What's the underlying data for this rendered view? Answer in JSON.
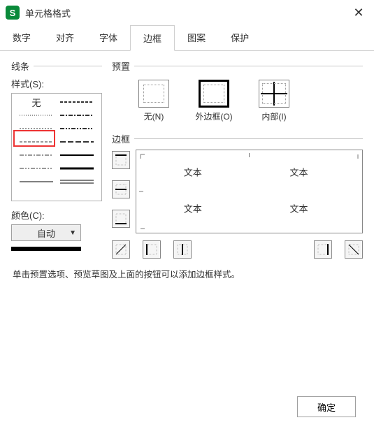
{
  "window": {
    "title": "单元格格式"
  },
  "tabs": [
    {
      "key": "number",
      "label": "数字"
    },
    {
      "key": "align",
      "label": "对齐"
    },
    {
      "key": "font",
      "label": "字体"
    },
    {
      "key": "border",
      "label": "边框",
      "active": true
    },
    {
      "key": "pattern",
      "label": "图案"
    },
    {
      "key": "protect",
      "label": "保护"
    }
  ],
  "line": {
    "section": "线条",
    "style_label": "样式(S):",
    "none_label": "无",
    "color_label": "颜色(C):",
    "color_value": "自动"
  },
  "preset": {
    "section": "预置",
    "none": "无(N)",
    "outer": "外边框(O)",
    "inner": "内部(I)"
  },
  "border": {
    "section": "边框",
    "sample": "文本"
  },
  "hint": "单击预置选项、预览草图及上面的按钮可以添加边框样式。",
  "buttons": {
    "ok": "确定"
  },
  "logo_text": "S"
}
